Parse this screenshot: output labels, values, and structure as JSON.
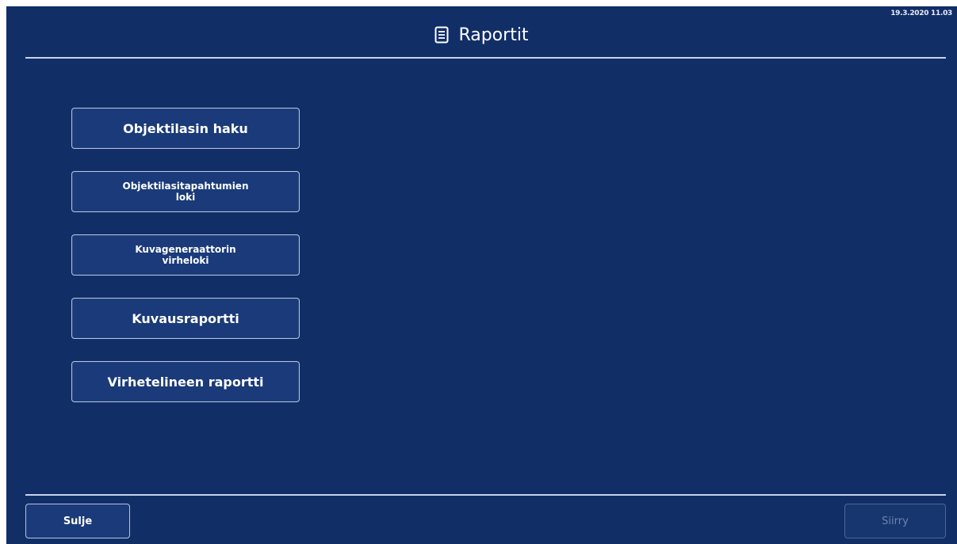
{
  "screen": {
    "timestamp": "19.3.2020 11.03",
    "title": "Raportit",
    "title_icon": "document-list-icon"
  },
  "menu": {
    "items": [
      {
        "label": "Objektilasin haku"
      },
      {
        "label": "Objektilasitapahtumien\nloki"
      },
      {
        "label": "Kuvageneraattorin\nvirheloki"
      },
      {
        "label": "Kuvausraportti"
      },
      {
        "label": "Virhetelineen raportti"
      }
    ]
  },
  "footer": {
    "close_label": "Sulje",
    "go_label": "Siirry",
    "go_state": "disabled"
  },
  "colors": {
    "background": "#112e67",
    "button_fill": "#1a3a79",
    "button_border": "#b7c3e0",
    "disabled_text": "#6f82ab"
  }
}
